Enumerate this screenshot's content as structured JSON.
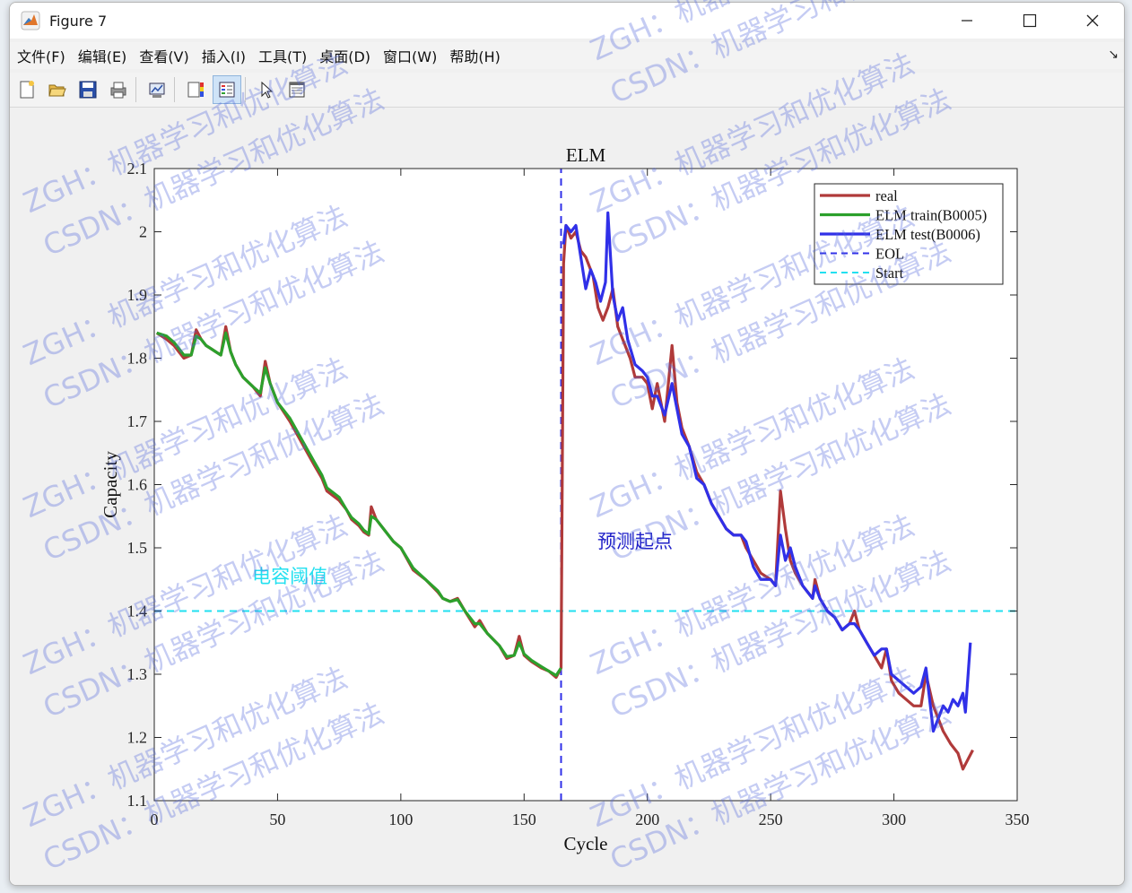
{
  "window": {
    "title": "Figure 7",
    "controls": [
      "minimize-icon",
      "maximize-icon",
      "close-icon"
    ]
  },
  "menu": {
    "items": [
      "文件(F)",
      "编辑(E)",
      "查看(V)",
      "插入(I)",
      "工具(T)",
      "桌面(D)",
      "窗口(W)",
      "帮助(H)"
    ]
  },
  "toolbar": {
    "icons": [
      "new-figure-icon",
      "open-file-icon",
      "save-icon",
      "print-icon",
      "link-plot-icon",
      "insert-colorbar-icon",
      "insert-legend-icon",
      "edit-plot-icon",
      "property-inspector-icon"
    ]
  },
  "watermark": {
    "line1": "ZGH：机器学习和优化算法",
    "line2": "CSDN：机器学习和优化算法",
    "color": "#5064dc"
  },
  "chart_data": {
    "type": "line",
    "title": "ELM",
    "xlabel": "Cycle",
    "ylabel": "Capacity",
    "xlim": [
      0,
      350
    ],
    "ylim": [
      1.1,
      2.1
    ],
    "xticks": [
      0,
      50,
      100,
      150,
      200,
      250,
      300,
      350
    ],
    "yticks": [
      1.1,
      1.2,
      1.3,
      1.4,
      1.5,
      1.6,
      1.7,
      1.8,
      1.9,
      2,
      2.1
    ],
    "grid": false,
    "legend_position": "top-right",
    "series": [
      {
        "name": "real",
        "color": "#b03a3a",
        "style": "solid",
        "points": [
          [
            1,
            1.84
          ],
          [
            5,
            1.83
          ],
          [
            8,
            1.82
          ],
          [
            10,
            1.81
          ],
          [
            12,
            1.8
          ],
          [
            15,
            1.805
          ],
          [
            17,
            1.845
          ],
          [
            19,
            1.83
          ],
          [
            21,
            1.82
          ],
          [
            23,
            1.815
          ],
          [
            25,
            1.81
          ],
          [
            27,
            1.805
          ],
          [
            29,
            1.85
          ],
          [
            31,
            1.81
          ],
          [
            33,
            1.79
          ],
          [
            36,
            1.77
          ],
          [
            40,
            1.755
          ],
          [
            43,
            1.74
          ],
          [
            45,
            1.795
          ],
          [
            47,
            1.76
          ],
          [
            50,
            1.73
          ],
          [
            55,
            1.7
          ],
          [
            60,
            1.665
          ],
          [
            65,
            1.63
          ],
          [
            68,
            1.61
          ],
          [
            70,
            1.59
          ],
          [
            75,
            1.575
          ],
          [
            78,
            1.56
          ],
          [
            80,
            1.545
          ],
          [
            83,
            1.535
          ],
          [
            85,
            1.525
          ],
          [
            87,
            1.52
          ],
          [
            88,
            1.565
          ],
          [
            90,
            1.545
          ],
          [
            93,
            1.53
          ],
          [
            97,
            1.51
          ],
          [
            100,
            1.5
          ],
          [
            105,
            1.465
          ],
          [
            110,
            1.45
          ],
          [
            115,
            1.43
          ],
          [
            117,
            1.42
          ],
          [
            120,
            1.415
          ],
          [
            123,
            1.42
          ],
          [
            126,
            1.4
          ],
          [
            130,
            1.375
          ],
          [
            132,
            1.385
          ],
          [
            135,
            1.365
          ],
          [
            140,
            1.345
          ],
          [
            143,
            1.325
          ],
          [
            146,
            1.33
          ],
          [
            148,
            1.36
          ],
          [
            150,
            1.33
          ],
          [
            153,
            1.32
          ],
          [
            157,
            1.31
          ],
          [
            160,
            1.305
          ],
          [
            163,
            1.295
          ],
          [
            165,
            1.31
          ],
          [
            166,
            1.95
          ],
          [
            167,
            2.01
          ],
          [
            169,
            1.99
          ],
          [
            171,
            2.0
          ],
          [
            173,
            1.97
          ],
          [
            175,
            1.96
          ],
          [
            178,
            1.93
          ],
          [
            180,
            1.88
          ],
          [
            182,
            1.86
          ],
          [
            184,
            1.88
          ],
          [
            186,
            1.91
          ],
          [
            188,
            1.85
          ],
          [
            190,
            1.83
          ],
          [
            193,
            1.8
          ],
          [
            195,
            1.77
          ],
          [
            198,
            1.77
          ],
          [
            200,
            1.76
          ],
          [
            202,
            1.72
          ],
          [
            204,
            1.76
          ],
          [
            207,
            1.7
          ],
          [
            210,
            1.82
          ],
          [
            212,
            1.73
          ],
          [
            214,
            1.69
          ],
          [
            217,
            1.66
          ],
          [
            220,
            1.62
          ],
          [
            223,
            1.6
          ],
          [
            226,
            1.57
          ],
          [
            229,
            1.55
          ],
          [
            232,
            1.53
          ],
          [
            235,
            1.52
          ],
          [
            238,
            1.52
          ],
          [
            240,
            1.5
          ],
          [
            243,
            1.48
          ],
          [
            246,
            1.46
          ],
          [
            250,
            1.45
          ],
          [
            252,
            1.44
          ],
          [
            254,
            1.59
          ],
          [
            256,
            1.53
          ],
          [
            258,
            1.48
          ],
          [
            260,
            1.46
          ],
          [
            263,
            1.44
          ],
          [
            265,
            1.43
          ],
          [
            267,
            1.42
          ],
          [
            268,
            1.45
          ],
          [
            270,
            1.42
          ],
          [
            273,
            1.4
          ],
          [
            276,
            1.39
          ],
          [
            279,
            1.37
          ],
          [
            282,
            1.38
          ],
          [
            284,
            1.4
          ],
          [
            286,
            1.37
          ],
          [
            289,
            1.35
          ],
          [
            292,
            1.33
          ],
          [
            295,
            1.31
          ],
          [
            297,
            1.34
          ],
          [
            299,
            1.29
          ],
          [
            302,
            1.27
          ],
          [
            305,
            1.26
          ],
          [
            308,
            1.25
          ],
          [
            311,
            1.25
          ],
          [
            313,
            1.3
          ],
          [
            316,
            1.25
          ],
          [
            318,
            1.23
          ],
          [
            320,
            1.21
          ],
          [
            323,
            1.19
          ],
          [
            326,
            1.175
          ],
          [
            328,
            1.15
          ],
          [
            330,
            1.165
          ],
          [
            332,
            1.18
          ]
        ]
      },
      {
        "name": "ELM train(B0005)",
        "color": "#2ca02c",
        "style": "solid",
        "points": [
          [
            1,
            1.84
          ],
          [
            5,
            1.835
          ],
          [
            8,
            1.825
          ],
          [
            10,
            1.815
          ],
          [
            12,
            1.805
          ],
          [
            15,
            1.805
          ],
          [
            17,
            1.835
          ],
          [
            19,
            1.83
          ],
          [
            21,
            1.82
          ],
          [
            23,
            1.815
          ],
          [
            25,
            1.81
          ],
          [
            27,
            1.805
          ],
          [
            29,
            1.84
          ],
          [
            31,
            1.81
          ],
          [
            33,
            1.79
          ],
          [
            36,
            1.77
          ],
          [
            40,
            1.755
          ],
          [
            43,
            1.745
          ],
          [
            45,
            1.785
          ],
          [
            47,
            1.76
          ],
          [
            50,
            1.73
          ],
          [
            55,
            1.705
          ],
          [
            60,
            1.67
          ],
          [
            65,
            1.635
          ],
          [
            68,
            1.615
          ],
          [
            70,
            1.595
          ],
          [
            75,
            1.58
          ],
          [
            78,
            1.56
          ],
          [
            80,
            1.548
          ],
          [
            83,
            1.538
          ],
          [
            85,
            1.528
          ],
          [
            87,
            1.522
          ],
          [
            88,
            1.55
          ],
          [
            90,
            1.545
          ],
          [
            93,
            1.53
          ],
          [
            97,
            1.51
          ],
          [
            100,
            1.5
          ],
          [
            105,
            1.468
          ],
          [
            110,
            1.45
          ],
          [
            115,
            1.432
          ],
          [
            117,
            1.42
          ],
          [
            120,
            1.415
          ],
          [
            123,
            1.418
          ],
          [
            126,
            1.4
          ],
          [
            130,
            1.38
          ],
          [
            132,
            1.38
          ],
          [
            135,
            1.365
          ],
          [
            140,
            1.345
          ],
          [
            143,
            1.328
          ],
          [
            146,
            1.33
          ],
          [
            148,
            1.35
          ],
          [
            150,
            1.332
          ],
          [
            153,
            1.322
          ],
          [
            157,
            1.312
          ],
          [
            160,
            1.305
          ],
          [
            163,
            1.298
          ],
          [
            165,
            1.31
          ]
        ]
      },
      {
        "name": "ELM test(B0006)",
        "color": "#3030e8",
        "style": "solid",
        "points": [
          [
            166,
            1.98
          ],
          [
            167,
            2.01
          ],
          [
            169,
            2.0
          ],
          [
            171,
            2.01
          ],
          [
            173,
            1.96
          ],
          [
            175,
            1.91
          ],
          [
            177,
            1.94
          ],
          [
            179,
            1.92
          ],
          [
            181,
            1.89
          ],
          [
            183,
            1.92
          ],
          [
            184,
            2.03
          ],
          [
            186,
            1.9
          ],
          [
            188,
            1.86
          ],
          [
            190,
            1.88
          ],
          [
            192,
            1.83
          ],
          [
            195,
            1.79
          ],
          [
            198,
            1.78
          ],
          [
            200,
            1.77
          ],
          [
            202,
            1.74
          ],
          [
            204,
            1.74
          ],
          [
            207,
            1.71
          ],
          [
            210,
            1.76
          ],
          [
            212,
            1.72
          ],
          [
            214,
            1.68
          ],
          [
            217,
            1.66
          ],
          [
            220,
            1.61
          ],
          [
            223,
            1.6
          ],
          [
            226,
            1.57
          ],
          [
            229,
            1.55
          ],
          [
            232,
            1.53
          ],
          [
            235,
            1.52
          ],
          [
            238,
            1.52
          ],
          [
            240,
            1.51
          ],
          [
            243,
            1.47
          ],
          [
            246,
            1.45
          ],
          [
            250,
            1.45
          ],
          [
            252,
            1.44
          ],
          [
            254,
            1.52
          ],
          [
            256,
            1.48
          ],
          [
            258,
            1.5
          ],
          [
            260,
            1.47
          ],
          [
            263,
            1.44
          ],
          [
            265,
            1.43
          ],
          [
            267,
            1.42
          ],
          [
            268,
            1.44
          ],
          [
            270,
            1.42
          ],
          [
            273,
            1.4
          ],
          [
            276,
            1.39
          ],
          [
            279,
            1.37
          ],
          [
            282,
            1.38
          ],
          [
            284,
            1.38
          ],
          [
            286,
            1.37
          ],
          [
            289,
            1.35
          ],
          [
            292,
            1.33
          ],
          [
            295,
            1.34
          ],
          [
            297,
            1.34
          ],
          [
            299,
            1.3
          ],
          [
            302,
            1.29
          ],
          [
            305,
            1.28
          ],
          [
            308,
            1.27
          ],
          [
            311,
            1.28
          ],
          [
            313,
            1.31
          ],
          [
            316,
            1.21
          ],
          [
            318,
            1.23
          ],
          [
            320,
            1.25
          ],
          [
            322,
            1.24
          ],
          [
            324,
            1.26
          ],
          [
            326,
            1.25
          ],
          [
            328,
            1.27
          ],
          [
            329,
            1.24
          ],
          [
            331,
            1.35
          ]
        ]
      },
      {
        "name": "EOL",
        "color": "#3030e8",
        "style": "dashed",
        "points": [
          [
            165,
            1.1
          ],
          [
            165,
            2.1
          ]
        ]
      },
      {
        "name": "Start",
        "color": "#22e0f0",
        "style": "dashed",
        "points": [
          [
            0,
            1.4
          ],
          [
            350,
            1.4
          ]
        ]
      }
    ],
    "annotations": [
      {
        "text": "电容阈值",
        "x": 55,
        "y": 1.445,
        "color": "#22e0f0"
      },
      {
        "text": "预测起点",
        "x": 195,
        "y": 1.5,
        "color": "#2020c8"
      }
    ]
  }
}
